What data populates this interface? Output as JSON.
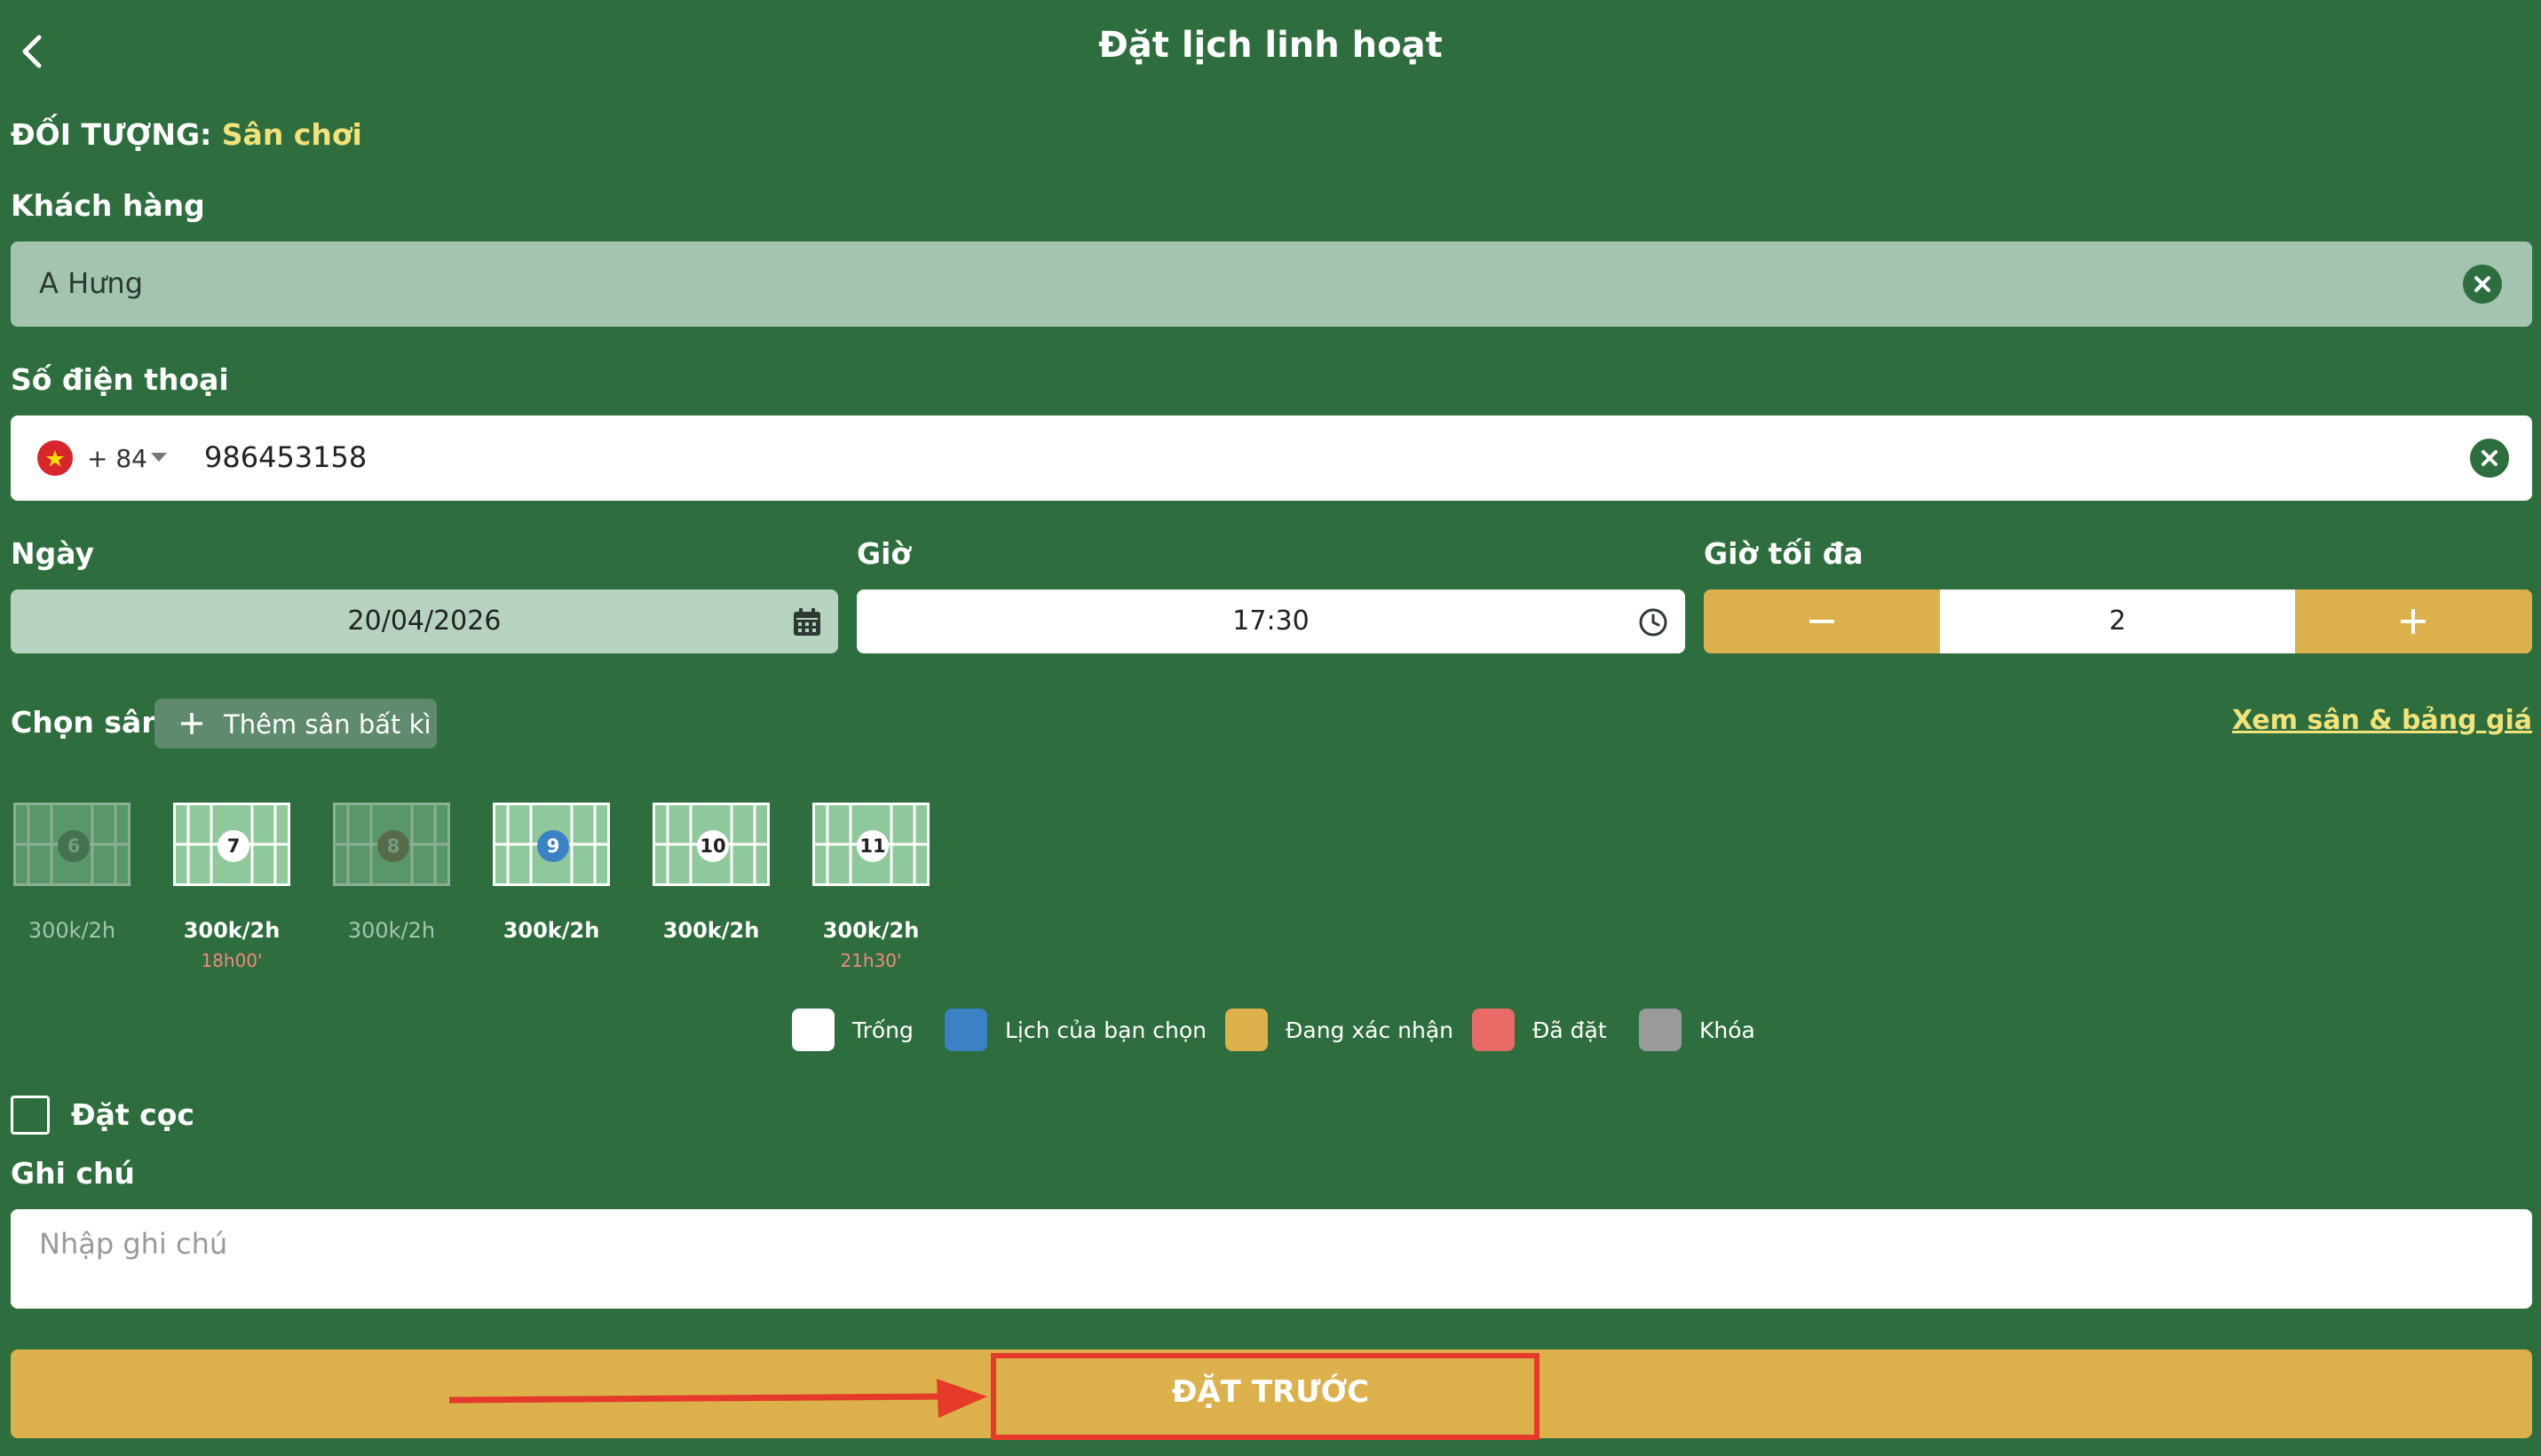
{
  "header": {
    "title": "Đặt lịch linh hoạt"
  },
  "target": {
    "label": "ĐỐI TƯỢNG:",
    "value": "Sân chơi"
  },
  "customer": {
    "label": "Khách hàng",
    "value": "A Hưng"
  },
  "phone": {
    "label": "Số điện thoại",
    "country_code": "+ 84",
    "value": "986453158"
  },
  "date": {
    "label": "Ngày",
    "value": "20/04/2026"
  },
  "time": {
    "label": "Giờ",
    "value": "17:30"
  },
  "max_hours": {
    "label": "Giờ tối đa",
    "value": "2",
    "minus": "−",
    "plus": "+"
  },
  "courts_section": {
    "label": "Chọn sân",
    "add_button": "Thêm sân bất kì",
    "view_link": "Xem sân & bảng giá"
  },
  "courts": [
    {
      "number": "6",
      "price": "300k/2h",
      "time": "",
      "status": "locked"
    },
    {
      "number": "7",
      "price": "300k/2h",
      "time": "18h00'",
      "status": "available"
    },
    {
      "number": "8",
      "price": "300k/2h",
      "time": "",
      "status": "locked"
    },
    {
      "number": "9",
      "price": "300k/2h",
      "time": "",
      "status": "selected"
    },
    {
      "number": "10",
      "price": "300k/2h",
      "time": "",
      "status": "available"
    },
    {
      "number": "11",
      "price": "300k/2h",
      "time": "21h30'",
      "status": "available"
    }
  ],
  "legend": [
    {
      "label": "Trống",
      "color": "#ffffff"
    },
    {
      "label": "Lịch của bạn chọn",
      "color": "#3b82c4"
    },
    {
      "label": "Đang xác nhận",
      "color": "#dcb04a"
    },
    {
      "label": "Đã đặt",
      "color": "#e86b68"
    },
    {
      "label": "Khóa",
      "color": "#9a9a9a"
    }
  ],
  "deposit": {
    "label": "Đặt cọc"
  },
  "notes": {
    "label": "Ghi chú",
    "placeholder": "Nhập ghi chú"
  },
  "submit": {
    "label": "ĐẶT TRƯỚC"
  },
  "colors": {
    "background": "#2e6d3e",
    "accent": "#dcb04a",
    "highlight": "#e53a2a"
  }
}
